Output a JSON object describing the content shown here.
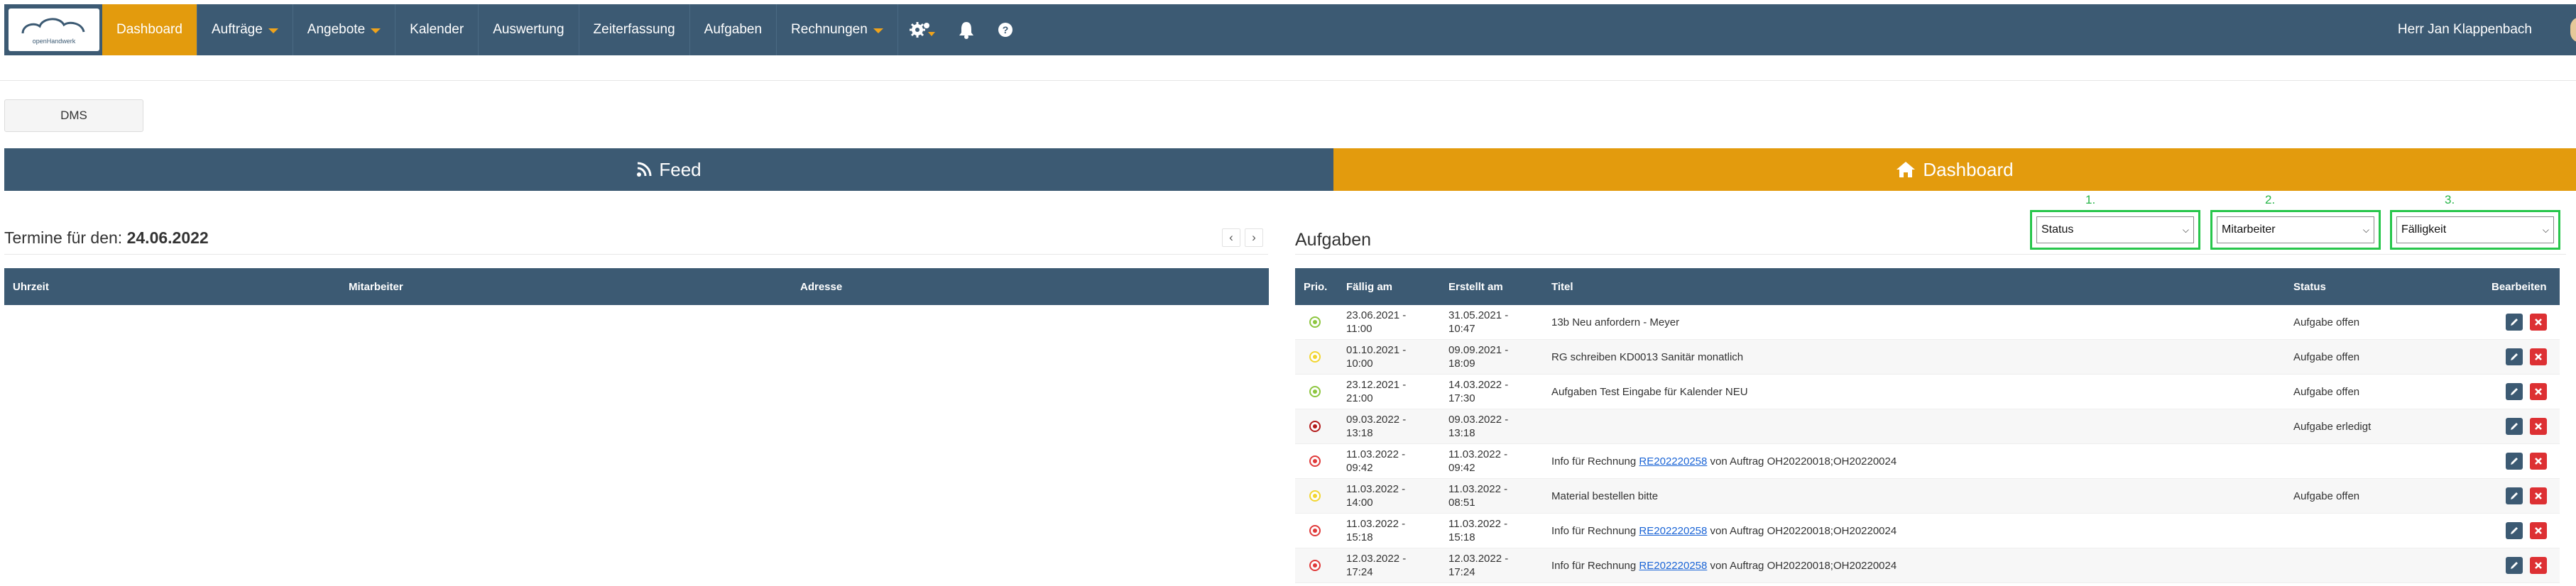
{
  "logo": {
    "text": "openHandwerk"
  },
  "nav": {
    "items": [
      {
        "label": "Dashboard",
        "active": true,
        "dropdown": false
      },
      {
        "label": "Aufträge",
        "active": false,
        "dropdown": true
      },
      {
        "label": "Angebote",
        "active": false,
        "dropdown": true
      },
      {
        "label": "Kalender",
        "active": false,
        "dropdown": false
      },
      {
        "label": "Auswertung",
        "active": false,
        "dropdown": false
      },
      {
        "label": "Zeiterfassung",
        "active": false,
        "dropdown": false
      },
      {
        "label": "Aufgaben",
        "active": false,
        "dropdown": false
      },
      {
        "label": "Rechnungen",
        "active": false,
        "dropdown": true
      }
    ],
    "icons": [
      "settings-gears-icon",
      "bell-icon",
      "help-icon"
    ]
  },
  "user": {
    "name": "Herr Jan Klappenbach"
  },
  "dms": {
    "label": "DMS"
  },
  "tabs": {
    "feed": "Feed",
    "dashboard": "Dashboard"
  },
  "termine": {
    "title_prefix": "Termine für den:",
    "date": "24.06.2022",
    "prev": "‹",
    "next": "›",
    "columns": [
      "Uhrzeit",
      "Mitarbeiter",
      "Adresse"
    ]
  },
  "aufgaben": {
    "title": "Aufgaben",
    "filters": [
      {
        "number": "1.",
        "value": "Status"
      },
      {
        "number": "2.",
        "value": "Mitarbeiter"
      },
      {
        "number": "3.",
        "value": "Fälligkeit"
      }
    ],
    "columns": {
      "prio": "Prio.",
      "faellig": "Fällig am",
      "erstellt": "Erstellt am",
      "titel": "Titel",
      "status": "Status",
      "bearbeiten": "Bearbeiten"
    },
    "colors": {
      "green": "#8dc63f",
      "yellow": "#f2d530",
      "red": "#e03a3a",
      "darkred": "#b31b1b"
    },
    "rows": [
      {
        "prio": "green",
        "faellig_1": "23.06.2021 -",
        "faellig_2": "11:00",
        "erstellt_1": "31.05.2021 -",
        "erstellt_2": "10:47",
        "titel": "13b Neu anfordern - Meyer",
        "link": "",
        "titel_suffix": "",
        "status": "Aufgabe offen"
      },
      {
        "prio": "yellow",
        "faellig_1": "01.10.2021 -",
        "faellig_2": "10:00",
        "erstellt_1": "09.09.2021 -",
        "erstellt_2": "18:09",
        "titel": "RG schreiben KD0013 Sanitär monatlich",
        "link": "",
        "titel_suffix": "",
        "status": "Aufgabe offen"
      },
      {
        "prio": "green",
        "faellig_1": "23.12.2021 -",
        "faellig_2": "21:00",
        "erstellt_1": "14.03.2022 -",
        "erstellt_2": "17:30",
        "titel": "Aufgaben Test Eingabe für Kalender NEU",
        "link": "",
        "titel_suffix": "",
        "status": "Aufgabe offen"
      },
      {
        "prio": "darkred",
        "faellig_1": "09.03.2022 -",
        "faellig_2": "13:18",
        "erstellt_1": "09.03.2022 -",
        "erstellt_2": "13:18",
        "titel": "",
        "link": "",
        "titel_suffix": "",
        "status": "Aufgabe erledigt"
      },
      {
        "prio": "red",
        "faellig_1": "11.03.2022 -",
        "faellig_2": "09:42",
        "erstellt_1": "11.03.2022 -",
        "erstellt_2": "09:42",
        "titel": "Info für Rechnung ",
        "link": "RE202220258",
        "titel_suffix": " von Auftrag OH20220018;OH20220024",
        "status": ""
      },
      {
        "prio": "yellow",
        "faellig_1": "11.03.2022 -",
        "faellig_2": "14:00",
        "erstellt_1": "11.03.2022 -",
        "erstellt_2": "08:51",
        "titel": "Material bestellen bitte",
        "link": "",
        "titel_suffix": "",
        "status": "Aufgabe offen"
      },
      {
        "prio": "red",
        "faellig_1": "11.03.2022 -",
        "faellig_2": "15:18",
        "erstellt_1": "11.03.2022 -",
        "erstellt_2": "15:18",
        "titel": "Info für Rechnung ",
        "link": "RE202220258",
        "titel_suffix": " von Auftrag OH20220018;OH20220024",
        "status": ""
      },
      {
        "prio": "red",
        "faellig_1": "12.03.2022 -",
        "faellig_2": "17:24",
        "erstellt_1": "12.03.2022 -",
        "erstellt_2": "17:24",
        "titel": "Info für Rechnung ",
        "link": "RE202220258",
        "titel_suffix": " von Auftrag OH20220018;OH20220024",
        "status": ""
      }
    ]
  }
}
